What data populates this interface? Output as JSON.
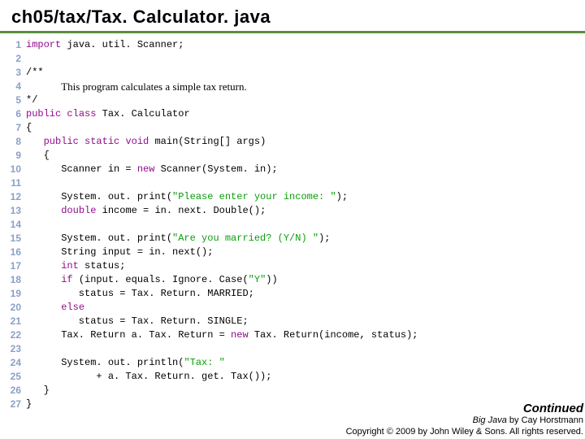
{
  "title": "ch05/tax/Tax. Calculator. java",
  "lines": [
    {
      "n": "1",
      "t": "import",
      "raw": "import java. util. Scanner;"
    },
    {
      "n": "2",
      "t": "blank",
      "raw": ""
    },
    {
      "n": "3",
      "t": "plain",
      "raw": "/**"
    },
    {
      "n": "4",
      "t": "comment",
      "raw": "      This program calculates a simple tax return."
    },
    {
      "n": "5",
      "t": "plain",
      "raw": "*/"
    },
    {
      "n": "6",
      "t": "class",
      "raw": "public class Tax. Calculator"
    },
    {
      "n": "7",
      "t": "plain",
      "raw": "{"
    },
    {
      "n": "8",
      "t": "main",
      "raw": "   public static void main(String[] args)"
    },
    {
      "n": "9",
      "t": "plain",
      "raw": "   {"
    },
    {
      "n": "10",
      "t": "scanner",
      "raw": "      Scanner in = new Scanner(System. in);"
    },
    {
      "n": "11",
      "t": "blank",
      "raw": ""
    },
    {
      "n": "12",
      "t": "print1",
      "raw": "      System. out. print(\"Please enter your income: \");"
    },
    {
      "n": "13",
      "t": "double",
      "raw": "      double income = in. next. Double();"
    },
    {
      "n": "14",
      "t": "blank",
      "raw": ""
    },
    {
      "n": "15",
      "t": "print2",
      "raw": "      System. out. print(\"Are you married? (Y/N) \");"
    },
    {
      "n": "16",
      "t": "plain",
      "raw": "      String input = in. next();"
    },
    {
      "n": "17",
      "t": "int",
      "raw": "      int status;"
    },
    {
      "n": "18",
      "t": "if",
      "raw": "      if (input. equals. Ignore. Case(\"Y\"))"
    },
    {
      "n": "19",
      "t": "plain",
      "raw": "         status = Tax. Return. MARRIED;"
    },
    {
      "n": "20",
      "t": "else",
      "raw": "      else"
    },
    {
      "n": "21",
      "t": "plain",
      "raw": "         status = Tax. Return. SINGLE;"
    },
    {
      "n": "22",
      "t": "new",
      "raw": "      Tax. Return a. Tax. Return = new Tax. Return(income, status);"
    },
    {
      "n": "23",
      "t": "blank",
      "raw": ""
    },
    {
      "n": "24",
      "t": "println",
      "raw": "      System. out. println(\"Tax: \""
    },
    {
      "n": "25",
      "t": "plain",
      "raw": "            + a. Tax. Return. get. Tax());"
    },
    {
      "n": "26",
      "t": "plain",
      "raw": "   }"
    },
    {
      "n": "27",
      "t": "plain",
      "raw": "}"
    }
  ],
  "kw": {
    "import": "import",
    "public": "public",
    "class": "class",
    "static": "static",
    "void": "void",
    "new": "new",
    "double": "double",
    "int": "int",
    "if": "if",
    "else": "else"
  },
  "str": {
    "s1": "\"Please enter your income: \"",
    "s2": "\"Are you married? (Y/N) \"",
    "s3": "\"Y\"",
    "s4": "\"Tax: \""
  },
  "footer": {
    "continued": "Continued",
    "line1_a": "Big Java",
    "line1_b": " by Cay Horstmann",
    "line2": "Copyright © 2009 by John Wiley & Sons. All rights reserved."
  }
}
